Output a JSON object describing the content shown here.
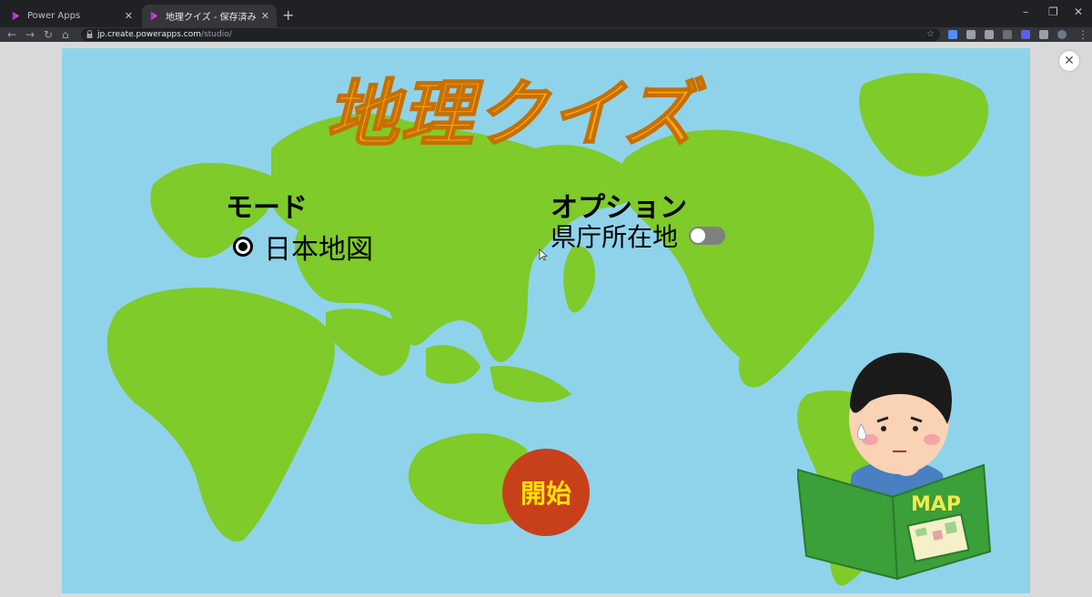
{
  "browser": {
    "tabs": [
      {
        "title": "Power Apps",
        "active": false
      },
      {
        "title": "地理クイズ - 保存済み (発行取り消",
        "active": true
      }
    ],
    "new_tab_label": "+",
    "close_tab_glyph": "✕",
    "address": {
      "host": "jp.create.powerapps.com",
      "path": "/studio/"
    },
    "window_controls": [
      "–",
      "❐",
      "✕"
    ],
    "nav_glyphs": {
      "back": "←",
      "forward": "→",
      "reload": "↻",
      "home": "⌂",
      "star": "☆",
      "menu": "⋮"
    }
  },
  "app": {
    "title": "地理クイズ",
    "mode": {
      "label": "モード",
      "selected_option": "日本地図"
    },
    "option": {
      "label": "オプション",
      "toggle_label": "県庁所在地",
      "toggle_on": false
    },
    "start_button_label": "開始",
    "close_glyph": "✕",
    "map_book_label": "MAP"
  },
  "colors": {
    "ocean": "#8fd3ea",
    "land": "#7ecb2a",
    "title": "#f6a51a",
    "start_button": "#c8401a",
    "start_text": "#ffe400"
  },
  "icons": [
    "powerapps-icon",
    "lock-icon",
    "star-icon",
    "extension-icon",
    "close-icon",
    "radio-selected-icon",
    "toggle-icon",
    "cursor-icon"
  ]
}
